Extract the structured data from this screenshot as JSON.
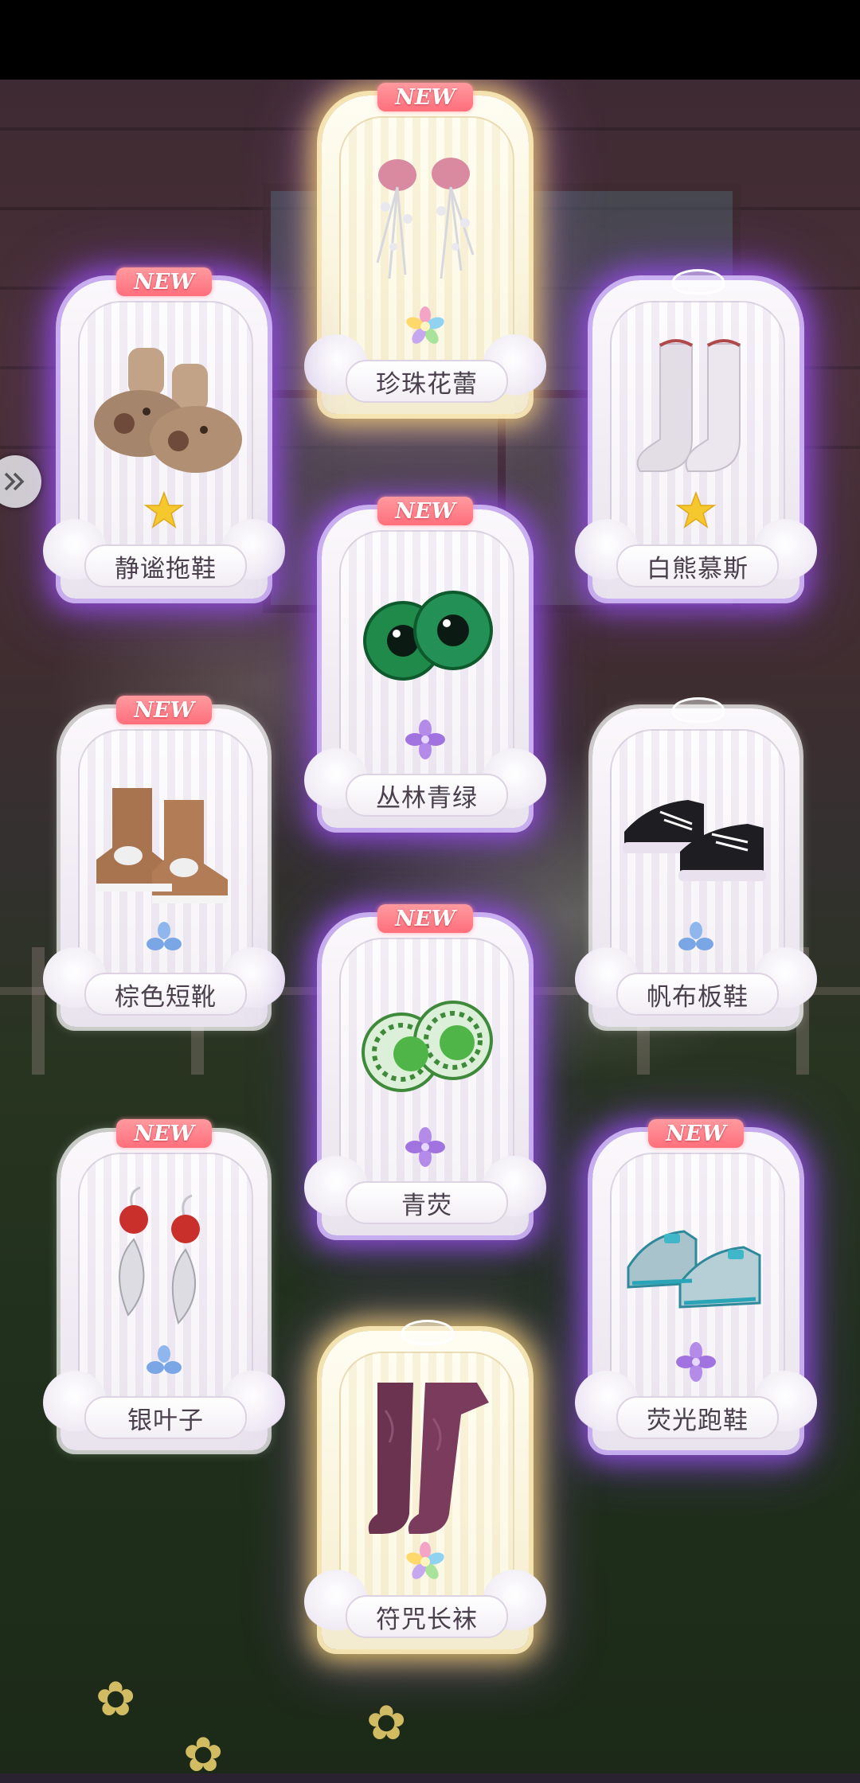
{
  "new_tag": "NEW",
  "cards": {
    "zhenzhu": {
      "name": "珍珠花蕾",
      "is_new": true,
      "rarity_icon": "rainbow-flower-icon"
    },
    "jingmi": {
      "name": "静谧拖鞋",
      "is_new": true,
      "rarity_icon": "gold-star-flower-icon"
    },
    "baixiong": {
      "name": "白熊慕斯",
      "is_new": false,
      "rarity_icon": "gold-star-flower-icon"
    },
    "conglin": {
      "name": "丛林青绿",
      "is_new": true,
      "rarity_icon": "purple-flower-icon"
    },
    "zongse": {
      "name": "棕色短靴",
      "is_new": true,
      "rarity_icon": "blue-leaf-icon"
    },
    "fanbu": {
      "name": "帆布板鞋",
      "is_new": false,
      "rarity_icon": "blue-leaf-icon"
    },
    "qingying": {
      "name": "青荧",
      "is_new": true,
      "rarity_icon": "purple-flower-icon"
    },
    "yinyezi": {
      "name": "银叶子",
      "is_new": true,
      "rarity_icon": "blue-leaf-icon"
    },
    "yingguang": {
      "name": "荧光跑鞋",
      "is_new": true,
      "rarity_icon": "purple-flower-icon"
    },
    "fuzhou": {
      "name": "符咒长袜",
      "is_new": false,
      "rarity_icon": "rainbow-flower-icon"
    }
  },
  "colors": {
    "glow_purple": "#9650e6",
    "glow_gold": "#ffdc6e",
    "new_tag": "#ff6f7c",
    "label_text": "#4a3f4d"
  }
}
